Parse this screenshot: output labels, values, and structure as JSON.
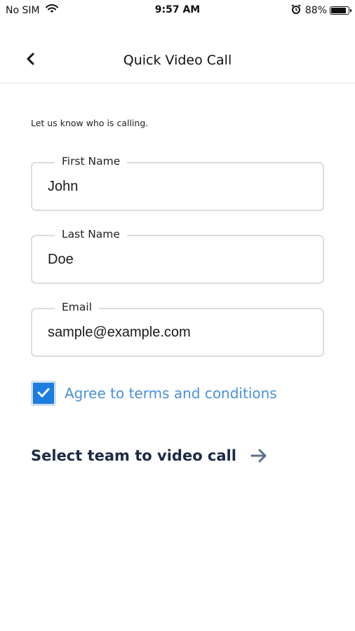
{
  "status_bar": {
    "carrier": "No SIM",
    "time": "9:57 AM",
    "battery_percent": "88%",
    "battery_level": 0.88,
    "icons": [
      "wifi-icon",
      "alarm-icon",
      "battery-icon"
    ]
  },
  "nav": {
    "title": "Quick Video Call",
    "back_icon": "chevron-left-icon"
  },
  "form": {
    "intro": "Let us know who is calling.",
    "first_name": {
      "label": "First Name",
      "value": "John"
    },
    "last_name": {
      "label": "Last Name",
      "value": "Doe"
    },
    "email": {
      "label": "Email",
      "value": "sample@example.com"
    },
    "terms": {
      "label": "Agree to terms and conditions",
      "checked": true
    }
  },
  "actions": {
    "select_team_label": "Select team to video call",
    "arrow_icon": "arrow-right-icon"
  },
  "colors": {
    "accent": "#1d7ce0",
    "link_text": "#4a90d9",
    "action_text": "#1c2a44",
    "arrow": "#5a6f8c",
    "field_border": "#dcdcdc"
  }
}
